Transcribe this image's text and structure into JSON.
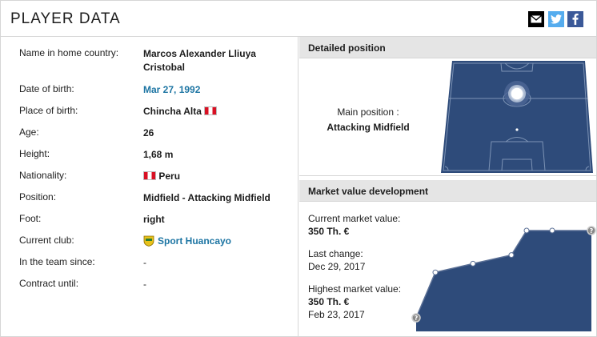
{
  "header": {
    "title": "PLAYER DATA",
    "share": [
      {
        "icon": "mail-icon",
        "color": "#000000"
      },
      {
        "icon": "twitter-icon",
        "color": "#55acee"
      },
      {
        "icon": "facebook-icon",
        "color": "#3b5998"
      }
    ]
  },
  "player": {
    "name_label": "Name in home country:",
    "name_value": "Marcos Alexander Lliuya Cristobal",
    "dob_label": "Date of birth:",
    "dob_value": "Mar 27, 1992",
    "pob_label": "Place of birth:",
    "pob_value": "Chincha Alta",
    "age_label": "Age:",
    "age_value": "26",
    "height_label": "Height:",
    "height_value": "1,68 m",
    "nationality_label": "Nationality:",
    "nationality_value": "Peru",
    "position_label": "Position:",
    "position_value": "Midfield - Attacking Midfield",
    "foot_label": "Foot:",
    "foot_value": "right",
    "club_label": "Current club:",
    "club_value": "Sport Huancayo",
    "since_label": "In the team since:",
    "since_value": "-",
    "contract_label": "Contract until:",
    "contract_value": "-"
  },
  "detailed_position": {
    "heading": "Detailed position",
    "main_label": "Main position :",
    "main_value": "Attacking Midfield",
    "pitch_color": "#2e4b7a"
  },
  "market_value": {
    "heading": "Market value development",
    "current_label": "Current market value:",
    "current_value": "350 Th. €",
    "last_change_label": "Last change:",
    "last_change_value": "Dec 29, 2017",
    "highest_label": "Highest market value:",
    "highest_value": "350 Th. €",
    "highest_date": "Feb 23, 2017",
    "marker_icon": "question-mark-icon",
    "fill_color": "#2e4b7a"
  },
  "chart_data": {
    "type": "area",
    "title": "",
    "xlabel": "",
    "ylabel": "",
    "series": [
      {
        "values": [
          40,
          205,
          235,
          265,
          350,
          350,
          350
        ]
      }
    ]
  }
}
